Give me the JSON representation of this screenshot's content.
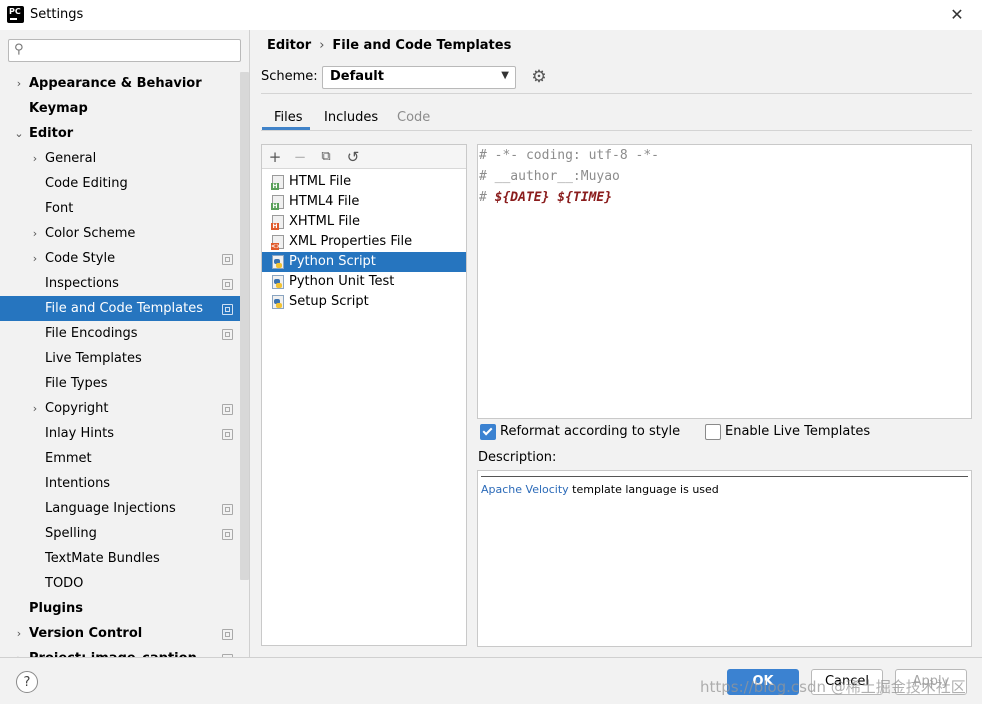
{
  "window": {
    "title": "Settings",
    "logo_text": "PC"
  },
  "search": {
    "placeholder": "",
    "value": ""
  },
  "sidebar": {
    "items": [
      {
        "label": "Appearance & Behavior",
        "arrow": "›",
        "bold": true,
        "level": 0
      },
      {
        "label": "Keymap",
        "arrow": "",
        "bold": true,
        "level": 0
      },
      {
        "label": "Editor",
        "arrow": "⌄",
        "bold": true,
        "level": 0
      },
      {
        "label": "General",
        "arrow": "›",
        "bold": false,
        "level": 1
      },
      {
        "label": "Code Editing",
        "arrow": "",
        "bold": false,
        "level": 1
      },
      {
        "label": "Font",
        "arrow": "",
        "bold": false,
        "level": 1
      },
      {
        "label": "Color Scheme",
        "arrow": "›",
        "bold": false,
        "level": 1
      },
      {
        "label": "Code Style",
        "arrow": "›",
        "bold": false,
        "level": 1,
        "project": true
      },
      {
        "label": "Inspections",
        "arrow": "",
        "bold": false,
        "level": 1,
        "project": true
      },
      {
        "label": "File and Code Templates",
        "arrow": "",
        "bold": false,
        "level": 1,
        "project": true,
        "selected": true
      },
      {
        "label": "File Encodings",
        "arrow": "",
        "bold": false,
        "level": 1,
        "project": true
      },
      {
        "label": "Live Templates",
        "arrow": "",
        "bold": false,
        "level": 1
      },
      {
        "label": "File Types",
        "arrow": "",
        "bold": false,
        "level": 1
      },
      {
        "label": "Copyright",
        "arrow": "›",
        "bold": false,
        "level": 1,
        "project": true
      },
      {
        "label": "Inlay Hints",
        "arrow": "",
        "bold": false,
        "level": 1,
        "project": true
      },
      {
        "label": "Emmet",
        "arrow": "",
        "bold": false,
        "level": 1
      },
      {
        "label": "Intentions",
        "arrow": "",
        "bold": false,
        "level": 1
      },
      {
        "label": "Language Injections",
        "arrow": "",
        "bold": false,
        "level": 1,
        "project": true
      },
      {
        "label": "Spelling",
        "arrow": "",
        "bold": false,
        "level": 1,
        "project": true
      },
      {
        "label": "TextMate Bundles",
        "arrow": "",
        "bold": false,
        "level": 1
      },
      {
        "label": "TODO",
        "arrow": "",
        "bold": false,
        "level": 1
      },
      {
        "label": "Plugins",
        "arrow": "",
        "bold": true,
        "level": 0
      },
      {
        "label": "Version Control",
        "arrow": "›",
        "bold": true,
        "level": 0,
        "project": true
      },
      {
        "label": "Project: image_caption",
        "arrow": "›",
        "bold": true,
        "level": 0,
        "project": true
      }
    ]
  },
  "breadcrumb": {
    "parent": "Editor",
    "separator": "›",
    "current": "File and Code Templates"
  },
  "scheme": {
    "label": "Scheme:",
    "value": "Default",
    "dropdown_icon": "▼",
    "gear_icon": "⚙"
  },
  "tabs": [
    {
      "label": "Files",
      "active": true
    },
    {
      "label": "Includes",
      "active": false
    },
    {
      "label": "Code",
      "active": false,
      "disabled": true
    }
  ],
  "toolbar": {
    "add": "+",
    "remove": "−",
    "copy": "⧉",
    "reset": "↺"
  },
  "templates": [
    {
      "label": "HTML File",
      "icon": "html-file-icon",
      "tag": "H",
      "tag_color": "#5aa05a"
    },
    {
      "label": "HTML4 File",
      "icon": "html4-file-icon",
      "tag": "H",
      "tag_color": "#5aa05a"
    },
    {
      "label": "XHTML File",
      "icon": "xhtml-file-icon",
      "tag": "H",
      "tag_color": "#e05a2b"
    },
    {
      "label": "XML Properties File",
      "icon": "xml-file-icon",
      "tag": "<>",
      "tag_color": "#e05a2b"
    },
    {
      "label": "Python Script",
      "icon": "python-file-icon",
      "selected": true
    },
    {
      "label": "Python Unit Test",
      "icon": "python-file-icon"
    },
    {
      "label": "Setup Script",
      "icon": "python-file-icon"
    }
  ],
  "editor": {
    "lines": [
      {
        "comment": "# -*- coding: utf-8 -*-",
        "vars": ""
      },
      {
        "comment": "# __author__:Muyao",
        "vars": ""
      },
      {
        "comment": "# ",
        "vars": "${DATE} ${TIME}"
      }
    ]
  },
  "options": {
    "reformat": {
      "label": "Reformat according to style",
      "checked": true
    },
    "live_templates": {
      "label": "Enable Live Templates",
      "checked": false
    }
  },
  "description": {
    "label": "Description:",
    "link": "Apache Velocity",
    "text": " template language is used"
  },
  "footer": {
    "help": "?",
    "ok": "OK",
    "cancel": "Cancel",
    "apply": "Apply",
    "watermark": "https://blog.csdn @稀土掘金技术社区"
  },
  "colors": {
    "selection": "#2675bf",
    "primary_button": "#3b82d1",
    "link": "#2b6ab8",
    "template_var": "#8a1c1c"
  }
}
